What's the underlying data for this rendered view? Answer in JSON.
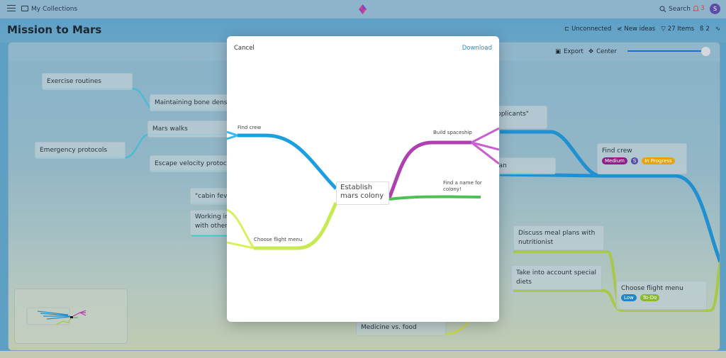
{
  "topbar": {
    "breadcrumb": "My Collections",
    "search_label": "Search",
    "notification_count": "3",
    "avatar_initial": "S"
  },
  "header": {
    "title": "Mission to Mars",
    "actions": {
      "unconnected": "Unconnected",
      "new_ideas": "New ideas",
      "items": "27 Items",
      "collaborators": "2"
    }
  },
  "canvas_toolbar": {
    "export_label": "Export",
    "center_label": "Center",
    "zoom_level": 0.95
  },
  "background_nodes": [
    {
      "id": "exercise",
      "text": "Exercise routines"
    },
    {
      "id": "bone",
      "text": "Maintaining bone densit"
    },
    {
      "id": "walks",
      "text": "Mars walks"
    },
    {
      "id": "emergency",
      "text": "Emergency protocols"
    },
    {
      "id": "escape",
      "text": "Escape velocity protocols"
    },
    {
      "id": "cabin",
      "text": "\"cabin feve"
    },
    {
      "id": "working",
      "text": "Working in\nwith other"
    },
    {
      "id": "applicants",
      "text": "pplicants\""
    },
    {
      "id": "plan",
      "text": "lan"
    },
    {
      "id": "meal",
      "text": "Discuss meal plans with nutritionist"
    },
    {
      "id": "diets",
      "text": "Take into account special diets"
    },
    {
      "id": "medicine",
      "text": "Medicine vs. food"
    }
  ],
  "task_nodes": {
    "find_crew": {
      "title": "Find crew",
      "priority": "Medium",
      "assignee": "S",
      "status": "In Progress"
    },
    "flight_menu": {
      "title": "Choose flight menu",
      "priority": "Low",
      "status": "To-Do"
    }
  },
  "colors": {
    "crew_branch": "#1b9fe0",
    "spaceship_branch": "#b040b0",
    "name_branch": "#4cc050",
    "menu_branch": "#c6ea50",
    "medium": "#8e1e8a",
    "in_progress": "#e8a20e",
    "low": "#1e86c8",
    "todo": "#8ab830",
    "download": "#2b8ad8"
  },
  "modal": {
    "cancel_label": "Cancel",
    "download_label": "Download",
    "root": "Establish mars colony",
    "branches": {
      "find_crew": "Find crew",
      "build_spaceship": "Build spaceship",
      "find_name": "Find a name for colony!",
      "choose_menu": "Choose flight menu"
    }
  }
}
